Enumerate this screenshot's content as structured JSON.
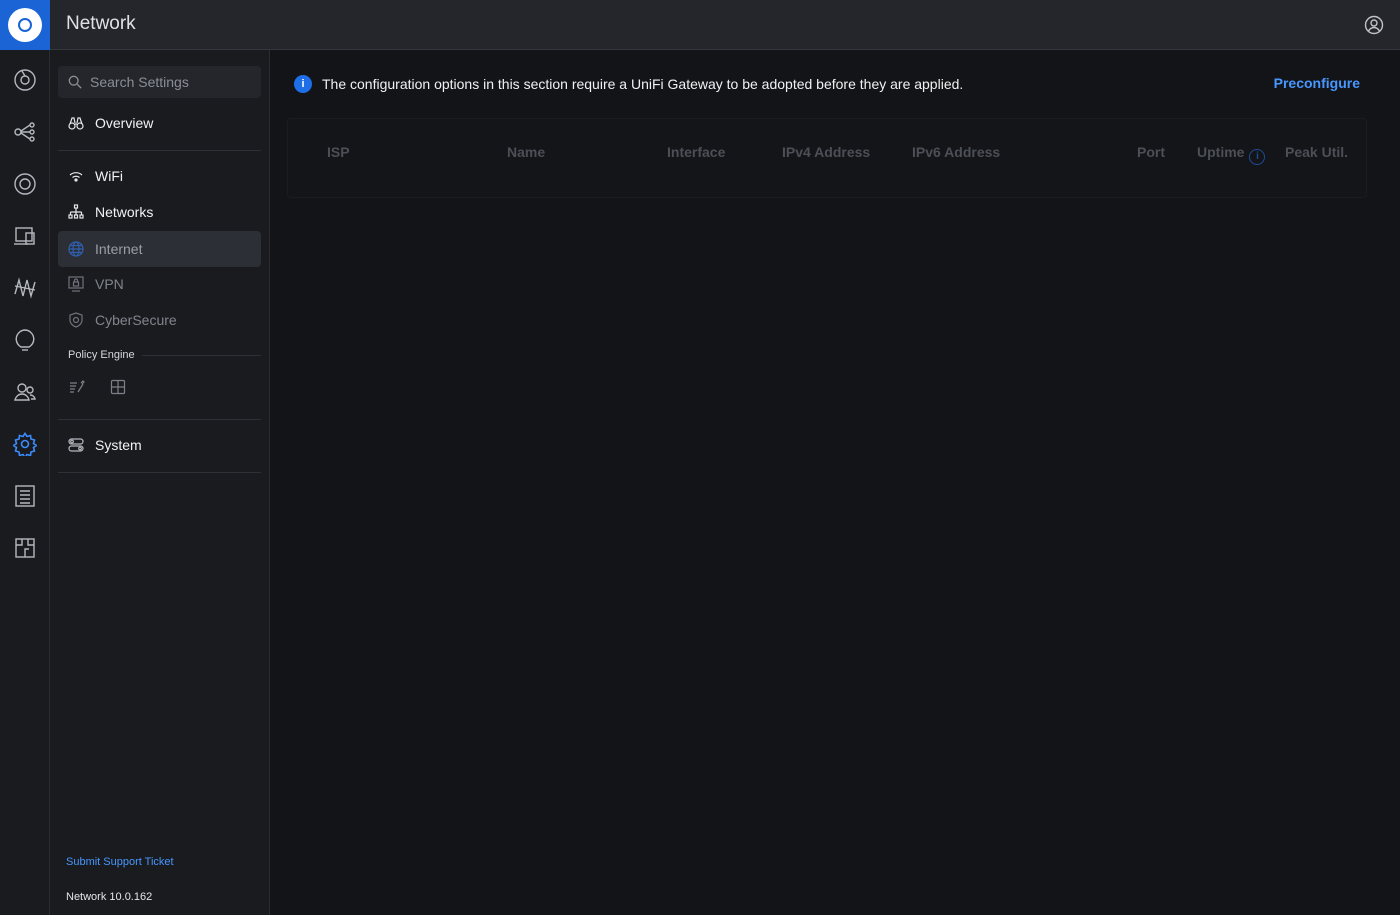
{
  "header": {
    "app_title": "Network"
  },
  "rail": {
    "items": [
      {
        "name": "dashboard-icon"
      },
      {
        "name": "topology-icon"
      },
      {
        "name": "devices-icon"
      },
      {
        "name": "client-devices-icon"
      },
      {
        "name": "insights-icon"
      },
      {
        "name": "hotspot-icon"
      },
      {
        "name": "users-icon"
      },
      {
        "name": "settings-icon",
        "active": true
      },
      {
        "name": "logs-icon"
      },
      {
        "name": "floorplan-icon"
      }
    ]
  },
  "sidebar": {
    "search_placeholder": "Search Settings",
    "items": {
      "overview": "Overview",
      "wifi": "WiFi",
      "networks": "Networks",
      "internet": "Internet",
      "vpn": "VPN",
      "cybersecure": "CyberSecure",
      "system": "System"
    },
    "policy_engine_label": "Policy Engine",
    "support_link": "Submit Support Ticket",
    "version": "Network 10.0.162"
  },
  "main": {
    "notice": "The configuration options in this section require a UniFi Gateway to be adopted before they are applied.",
    "preconfigure_label": "Preconfigure",
    "table_headers": {
      "isp": "ISP",
      "name": "Name",
      "interface": "Interface",
      "ipv4": "IPv4 Address",
      "ipv6": "IPv6 Address",
      "port": "Port",
      "uptime": "Uptime",
      "peak": "Peak Util."
    }
  },
  "colors": {
    "accent": "#1b64d6",
    "link": "#4797ff",
    "background": "#131417",
    "panel": "#1a1b1f"
  }
}
